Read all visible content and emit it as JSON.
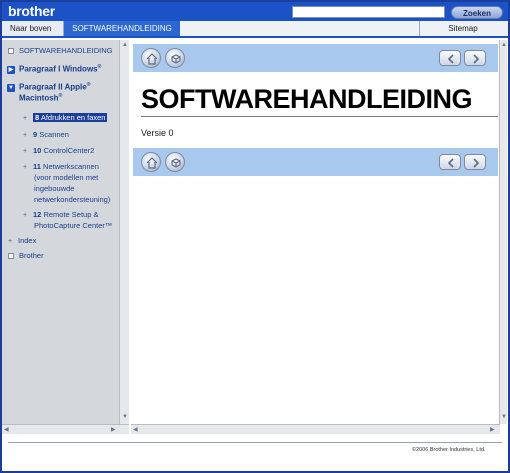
{
  "header": {
    "logo_text": "brother",
    "search_placeholder": "",
    "search_button_label": "Zoeken"
  },
  "navbar": {
    "top_link": "Naar boven",
    "active_tab": "SOFTWAREHANDLEIDING",
    "sitemap": "Sitemap"
  },
  "sidebar": {
    "items": [
      {
        "label": "SOFTWAREHANDLEIDING",
        "icon": "page-icon"
      },
      {
        "label": "Paragraaf I Windows",
        "sup": "®",
        "icon": "collapsed-triangle-icon"
      },
      {
        "label": "Paragraaf II Apple",
        "sup": "®",
        "label2": "Macintosh",
        "sup2": "®",
        "icon": "expanded-triangle-icon"
      },
      {
        "num": "8",
        "label": "Afdrukken en faxen",
        "selected": true
      },
      {
        "num": "9",
        "label": "Scannen"
      },
      {
        "num": "10",
        "label": "ControlCenter2"
      },
      {
        "num": "11",
        "label": "Netwerkscannen",
        "label2": "(voor modellen met",
        "label3": "ingebouwde",
        "label4": "netwerkondersteuning)"
      },
      {
        "num": "12",
        "label": "Remote Setup &",
        "label2": "PhotoCapture Center™"
      },
      {
        "label": "Index",
        "icon": "plus-icon"
      },
      {
        "label": "Brother",
        "icon": "page-icon"
      }
    ]
  },
  "content": {
    "title": "SOFTWAREHANDLEIDING",
    "version": "Versie 0"
  },
  "footer": {
    "copyright": "©2006 Brother Industries, Ltd."
  },
  "colors": {
    "banner": "#1b53c6",
    "toolbar": "#a9c8ee",
    "sidebar": "#d4d7dc",
    "selected": "#1b3e9c"
  }
}
